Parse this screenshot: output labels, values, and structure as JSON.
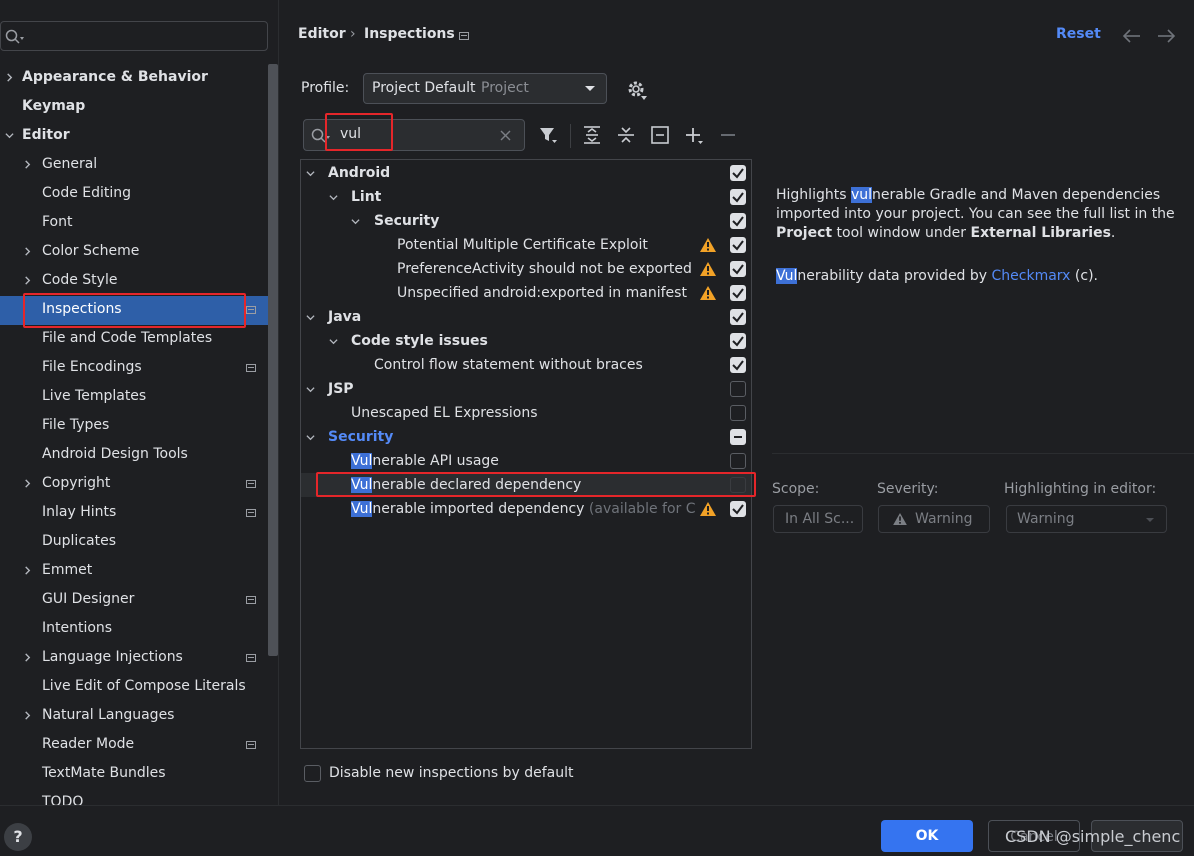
{
  "sidebar": {
    "search_placeholder": "",
    "items": [
      {
        "label": "Appearance & Behavior"
      },
      {
        "label": "Keymap"
      },
      {
        "label": "Editor"
      },
      {
        "label": "General"
      },
      {
        "label": "Code Editing"
      },
      {
        "label": "Font"
      },
      {
        "label": "Color Scheme"
      },
      {
        "label": "Code Style"
      },
      {
        "label": "Inspections"
      },
      {
        "label": "File and Code Templates"
      },
      {
        "label": "File Encodings"
      },
      {
        "label": "Live Templates"
      },
      {
        "label": "File Types"
      },
      {
        "label": "Android Design Tools"
      },
      {
        "label": "Copyright"
      },
      {
        "label": "Inlay Hints"
      },
      {
        "label": "Duplicates"
      },
      {
        "label": "Emmet"
      },
      {
        "label": "GUI Designer"
      },
      {
        "label": "Intentions"
      },
      {
        "label": "Language Injections"
      },
      {
        "label": "Live Edit of Compose Literals"
      },
      {
        "label": "Natural Languages"
      },
      {
        "label": "Reader Mode"
      },
      {
        "label": "TextMate Bundles"
      },
      {
        "label": "TODO"
      }
    ]
  },
  "breadcrumb": {
    "root": "Editor",
    "separator": "›",
    "current": "Inspections"
  },
  "header": {
    "reset": "Reset"
  },
  "profile": {
    "label": "Profile:",
    "name": "Project Default",
    "scope": "Project"
  },
  "filter": {
    "value": "vul"
  },
  "tree": {
    "android": "Android",
    "lint": "Lint",
    "security_group": "Security",
    "pmce": "Potential Multiple Certificate Exploit",
    "prefact": "PreferenceActivity should not be exported",
    "unspec": "Unspecified android:exported in manifest",
    "java": "Java",
    "codestyle": "Code style issues",
    "cfs": "Control flow statement without braces",
    "jsp": "JSP",
    "unescaped": "Unescaped EL Expressions",
    "security": "Security",
    "vul_prefix": "Vul",
    "api_rest": "nerable API usage",
    "declared_rest": "nerable declared dependency",
    "imported_rest": "nerable imported dependency",
    "imported_note": "(available for Coc"
  },
  "description": {
    "p1_a": "Highlights ",
    "p1_hl": "vul",
    "p1_b": "nerable Gradle and Maven dependencies imported into your project. You can see the full list in the ",
    "p1_bold1": "Project",
    "p1_c": " tool window under ",
    "p1_bold2": "External Libraries",
    "p1_d": ".",
    "p2_hl": "Vul",
    "p2_a": "nerability data provided by ",
    "p2_link": "Checkmarx",
    "p2_b": " (c)."
  },
  "options": {
    "scope_label": "Scope:",
    "scope_value": "In All Sc...",
    "severity_label": "Severity:",
    "severity_value": "Warning",
    "highlight_label": "Highlighting in editor:",
    "highlight_value": "Warning"
  },
  "disable_new": "Disable new inspections by default",
  "footer": {
    "ok": "OK",
    "cancel": "Cancel",
    "watermark": "CSDN @simple_chenc"
  },
  "colors": {
    "accent": "#548af7",
    "selection": "#2e5fa8",
    "highlight": "#3d70d6",
    "warning": "#f2a227",
    "annotation": "#e5262a"
  }
}
